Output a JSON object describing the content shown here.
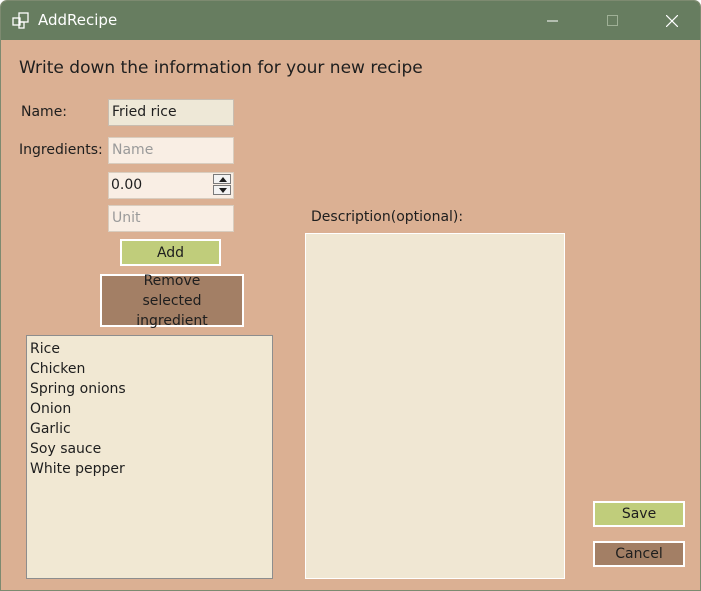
{
  "window": {
    "title": "AddRecipe"
  },
  "heading": "Write down the information for your new recipe",
  "labels": {
    "name": "Name:",
    "ingredients": "Ingredients:",
    "description": "Description(optional):"
  },
  "fields": {
    "recipe_name": "Fried rice",
    "ingredient_name_placeholder": "Name",
    "amount": "0.00",
    "unit_placeholder": "Unit"
  },
  "buttons": {
    "add": "Add",
    "remove": "Remove selected ingredient",
    "save": "Save",
    "cancel": "Cancel"
  },
  "ingredients": [
    "Rice",
    "Chicken",
    "Spring onions",
    "Onion",
    "Garlic",
    "Soy sauce",
    "White pepper"
  ],
  "colors": {
    "background": "#dbb093",
    "titlebar": "#677d60",
    "green_button": "#c0cd7b",
    "brown_button": "#a37f65"
  }
}
